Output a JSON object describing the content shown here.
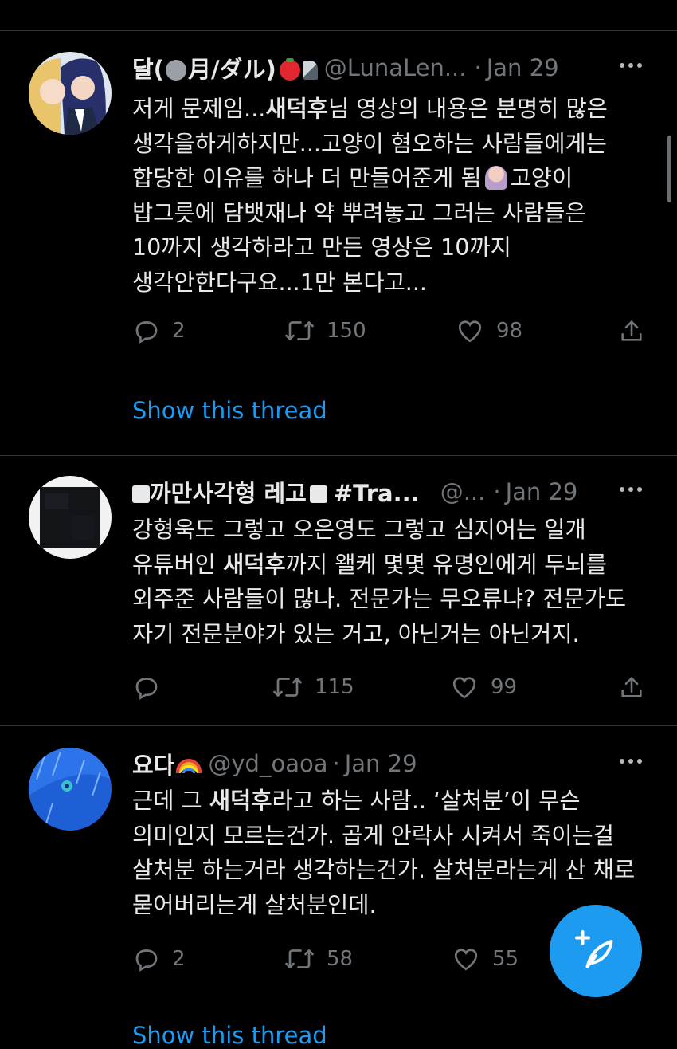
{
  "tweets": [
    {
      "name": "달(",
      "name_part2": "月/ダル)",
      "handle": "@LunaLen...",
      "separator": "·",
      "time": "Jan 29",
      "body_segments": [
        "저게 문제임...",
        "새덕후",
        "님 영상의 내용은 분명히 많은 생각을하게하지만...고양이 혐오하는 사람들에게는 합당한 이유를 하나 더 만들어준게 됨",
        "고양이 밥그릇에 담뱃재나 약 뿌려놓고 그러는 사람들은 10까지 생각하라고 만든 영상은 10까지 생각안한다구요...1만 본다고..."
      ],
      "replies": "2",
      "retweets": "150",
      "likes": "98",
      "show_thread": "Show this thread"
    },
    {
      "name": "까만사각형 레고",
      "name_part2": "#Tra...",
      "handle": "@...",
      "separator": "·",
      "time": "Jan 29",
      "body_segments": [
        "강형욱도 그렇고 오은영도 그렇고 심지어는 일개 유튜버인 ",
        "새덕후",
        "까지 왤케 몇몇 유명인에게 두뇌를 외주준 사람들이 많나. 전문가는 무오류냐? 전문가도 자기 전문분야가 있는 거고, 아닌거는 아닌거지."
      ],
      "replies": "",
      "retweets": "115",
      "likes": "99"
    },
    {
      "name": "요다",
      "handle": "@yd_oaoa",
      "separator": "·",
      "time": "Jan 29",
      "body_segments": [
        "근데 그 ",
        "새덕후",
        "라고 하는 사람.. ‘살처분’이 무슨 의미인지 모르는건가. 곱게 안락사 시켜서 죽이는걸 살처분 하는거라 생각하는건가. 살처분라는게 산 채로 묻어버리는게 살처분인데."
      ],
      "replies": "2",
      "retweets": "58",
      "likes": "55",
      "show_thread": "Show this thread"
    }
  ],
  "icons": {
    "reply": "reply-icon",
    "retweet": "retweet-icon",
    "like": "heart-icon",
    "share": "share-icon",
    "more": "more-icon",
    "compose": "compose-tweet-icon"
  },
  "colors": {
    "background": "#000000",
    "text": "#e7e9ea",
    "secondary": "#71767b",
    "accent": "#1d9bf0",
    "divider": "#2f3336"
  }
}
